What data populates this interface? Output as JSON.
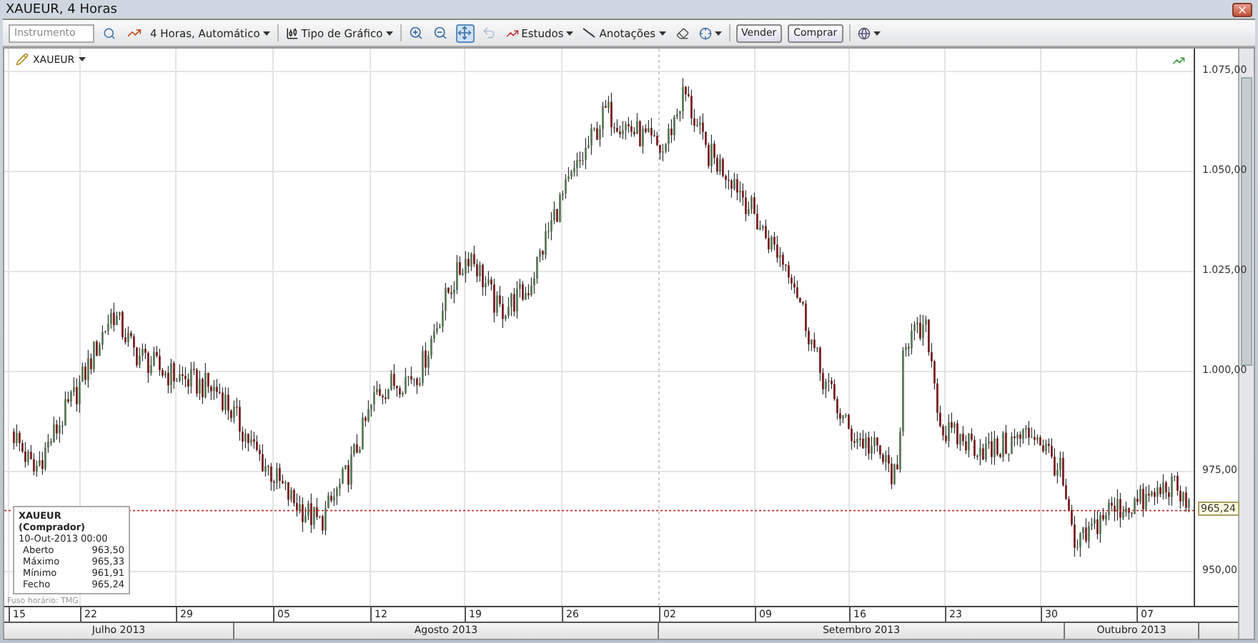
{
  "window": {
    "title": "XAUEUR, 4 Horas"
  },
  "toolbar": {
    "instrument_field": {
      "placeholder": "Instrumento"
    },
    "interval": "4 Horas,  Automático",
    "chart_type": "Tipo de Gráfico",
    "tools": [
      {
        "kind": "zoom-in",
        "selected": false,
        "disabled": false
      },
      {
        "kind": "zoom-out",
        "selected": false,
        "disabled": false
      },
      {
        "kind": "pan",
        "selected": true,
        "disabled": false
      },
      {
        "kind": "undo",
        "selected": false,
        "disabled": true
      }
    ],
    "studies": "Estudos",
    "annotations": "Anotações",
    "actions": [
      "Vender",
      "Comprar"
    ]
  },
  "chart": {
    "symbol": "XAUEUR",
    "price_labels": [
      "1.075,00",
      "1.050,00",
      "1.025,00",
      "1.000,00",
      "975,00",
      "950,00"
    ],
    "current_price": "965,24",
    "legend": {
      "title": "XAUEUR (Comprador)",
      "datetime": "10-Out-2013 00:00",
      "rows": [
        {
          "label": "Aberto",
          "value": "963,50"
        },
        {
          "label": "Máximo",
          "value": "965,33"
        },
        {
          "label": "Mínimo",
          "value": "961,91"
        },
        {
          "label": "Fecho",
          "value": "965,24"
        }
      ]
    },
    "timezone_note": "Fuso horário: TMG",
    "days": [
      "15",
      "22",
      "29",
      "05",
      "12",
      "19",
      "26",
      "02",
      "09",
      "16",
      "23",
      "30",
      "07"
    ],
    "months": [
      "Julho 2013",
      "Agosto 2013",
      "Setembro 2013",
      "Outubro 2013"
    ]
  }
}
